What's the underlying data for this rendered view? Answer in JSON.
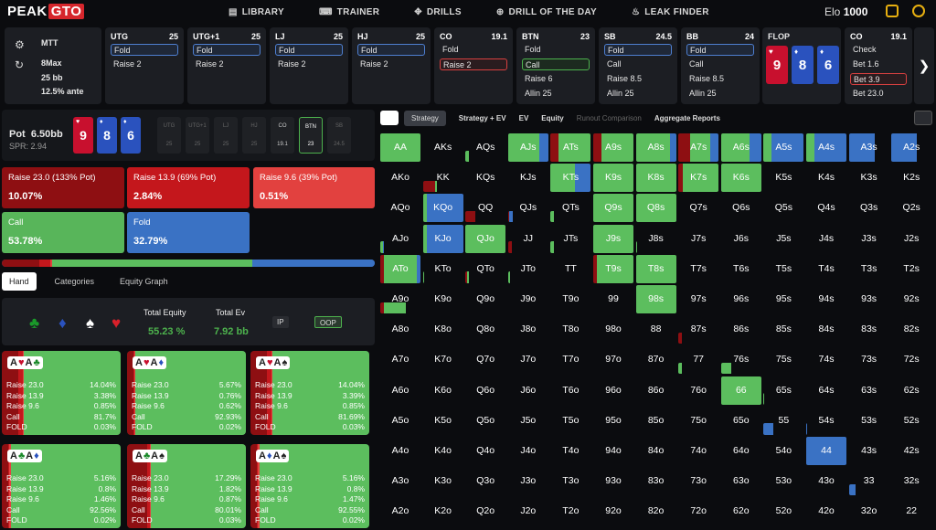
{
  "header": {
    "logo_a": "PEAK",
    "logo_b": "GTO",
    "nav": [
      {
        "label": "LIBRARY",
        "icon": "book-icon"
      },
      {
        "label": "TRAINER",
        "icon": "gamepad-icon"
      },
      {
        "label": "DRILLS",
        "icon": "target-icon"
      },
      {
        "label": "DRILL OF THE DAY",
        "icon": "plus-circle-icon"
      },
      {
        "label": "LEAK FINDER",
        "icon": "flame-icon"
      }
    ],
    "elo_label": "Elo",
    "elo_value": "1000"
  },
  "config": {
    "game": "MTT",
    "table": "8Max",
    "stack": "25 bb",
    "ante": "12.5% ante"
  },
  "positions": [
    {
      "name": "UTG",
      "amount": "25",
      "actions": [
        "Fold",
        "Raise 2"
      ],
      "sel": 0,
      "style": "sel"
    },
    {
      "name": "UTG+1",
      "amount": "25",
      "actions": [
        "Fold",
        "Raise 2"
      ],
      "sel": 0,
      "style": "sel"
    },
    {
      "name": "LJ",
      "amount": "25",
      "actions": [
        "Fold",
        "Raise 2"
      ],
      "sel": 0,
      "style": "sel"
    },
    {
      "name": "HJ",
      "amount": "25",
      "actions": [
        "Fold",
        "Raise 2"
      ],
      "sel": 0,
      "style": "sel"
    },
    {
      "name": "CO",
      "amount": "19.1",
      "actions": [
        "Fold",
        "Raise 2"
      ],
      "sel": 1,
      "style": "selr"
    },
    {
      "name": "BTN",
      "amount": "23",
      "actions": [
        "Fold",
        "Call",
        "Raise 6",
        "Allin 25"
      ],
      "sel": 1,
      "style": "selg"
    },
    {
      "name": "SB",
      "amount": "24.5",
      "actions": [
        "Fold",
        "Call",
        "Raise 8.5",
        "Allin 25"
      ],
      "sel": 0,
      "style": "sel"
    },
    {
      "name": "BB",
      "amount": "24",
      "actions": [
        "Fold",
        "Call",
        "Raise 8.5",
        "Allin 25"
      ],
      "sel": 0,
      "style": "sel"
    }
  ],
  "flop": {
    "label": "FLOP",
    "cards": [
      {
        "r": "9",
        "s": "♥",
        "c": "#c8102e"
      },
      {
        "r": "8",
        "s": "♦",
        "c": "#2a52be"
      },
      {
        "r": "6",
        "s": "♦",
        "c": "#2a52be"
      }
    ]
  },
  "co_col": {
    "name": "CO",
    "amount": "19.1",
    "actions": [
      "Check",
      "Bet 1.6",
      "Bet 3.9",
      "Bet 23.0"
    ],
    "sel": 2
  },
  "board": {
    "pot_label": "Pot",
    "pot": "6.50bb",
    "spr": "SPR: 2.94",
    "seats": [
      {
        "n": "UTG",
        "v": "25"
      },
      {
        "n": "UTG+1",
        "v": "25"
      },
      {
        "n": "LJ",
        "v": "25"
      },
      {
        "n": "HJ",
        "v": "25"
      },
      {
        "n": "CO",
        "v": "19.1"
      },
      {
        "n": "BTN",
        "v": "23"
      },
      {
        "n": "SB",
        "v": "24.5"
      }
    ]
  },
  "actions": [
    {
      "label": "Raise 23.0 (133% Pot)",
      "pct": "10.07%",
      "color": "#8e0f12"
    },
    {
      "label": "Raise 13.9 (69% Pot)",
      "pct": "2.84%",
      "color": "#c4171c"
    },
    {
      "label": "Raise 9.6 (39% Pot)",
      "pct": "0.51%",
      "color": "#e2413f"
    },
    {
      "label": "Call",
      "pct": "53.78%",
      "color": "#58b55a"
    },
    {
      "label": "Fold",
      "pct": "32.79%",
      "color": "#3a72c4"
    }
  ],
  "freq": [
    10.07,
    2.84,
    0.51,
    53.78,
    32.79
  ],
  "tabs": [
    "Hand",
    "Categories",
    "Equity Graph"
  ],
  "equity": {
    "te_label": "Total Equity",
    "te": "55.23 %",
    "ev_label": "Total Ev",
    "ev": "7.92 bb",
    "ip": "IP",
    "oop": "OOP"
  },
  "combos": [
    {
      "cards": [
        [
          "A",
          "♥",
          "#c8102e"
        ],
        [
          "A",
          "♣",
          "#1a8a2a"
        ]
      ],
      "rows": [
        [
          "Raise 23.0",
          "14.04%"
        ],
        [
          "Raise 13.9",
          "3.38%"
        ],
        [
          "Raise 9.6",
          "0.85%"
        ],
        [
          "Call",
          "81.7%"
        ],
        [
          "FOLD",
          "0.03%"
        ]
      ]
    },
    {
      "cards": [
        [
          "A",
          "♥",
          "#c8102e"
        ],
        [
          "A",
          "♦",
          "#2a52be"
        ]
      ],
      "rows": [
        [
          "Raise 23.0",
          "5.67%"
        ],
        [
          "Raise 13.9",
          "0.76%"
        ],
        [
          "Raise 9.6",
          "0.62%"
        ],
        [
          "Call",
          "92.93%"
        ],
        [
          "FOLD",
          "0.02%"
        ]
      ]
    },
    {
      "cards": [
        [
          "A",
          "♥",
          "#c8102e"
        ],
        [
          "A",
          "♠",
          "#222"
        ]
      ],
      "rows": [
        [
          "Raise 23.0",
          "14.04%"
        ],
        [
          "Raise 13.9",
          "3.39%"
        ],
        [
          "Raise 9.6",
          "0.85%"
        ],
        [
          "Call",
          "81.69%"
        ],
        [
          "FOLD",
          "0.03%"
        ]
      ]
    },
    {
      "cards": [
        [
          "A",
          "♣",
          "#1a8a2a"
        ],
        [
          "A",
          "♦",
          "#2a52be"
        ]
      ],
      "rows": [
        [
          "Raise 23.0",
          "5.16%"
        ],
        [
          "Raise 13.9",
          "0.8%"
        ],
        [
          "Raise 9.6",
          "1.46%"
        ],
        [
          "Call",
          "92.56%"
        ],
        [
          "FOLD",
          "0.02%"
        ]
      ]
    },
    {
      "cards": [
        [
          "A",
          "♣",
          "#1a8a2a"
        ],
        [
          "A",
          "♠",
          "#222"
        ]
      ],
      "rows": [
        [
          "Raise 23.0",
          "17.29%"
        ],
        [
          "Raise 13.9",
          "1.82%"
        ],
        [
          "Raise 9.6",
          "0.87%"
        ],
        [
          "Call",
          "80.01%"
        ],
        [
          "FOLD",
          "0.03%"
        ]
      ]
    },
    {
      "cards": [
        [
          "A",
          "♦",
          "#2a52be"
        ],
        [
          "A",
          "♠",
          "#222"
        ]
      ],
      "rows": [
        [
          "Raise 23.0",
          "5.16%"
        ],
        [
          "Raise 13.9",
          "0.8%"
        ],
        [
          "Raise 9.6",
          "1.47%"
        ],
        [
          "Call",
          "92.55%"
        ],
        [
          "FOLD",
          "0.02%"
        ]
      ]
    }
  ],
  "grid_tabs": [
    "Strategy",
    "Strategy + EV",
    "EV",
    "Equity",
    "Runout Comparison",
    "Aggregate Reports"
  ],
  "ranks": [
    "A",
    "K",
    "Q",
    "J",
    "T",
    "9",
    "8",
    "7",
    "6",
    "5",
    "4",
    "3",
    "2"
  ],
  "hands": [
    {
      "h": "AA",
      "m": [
        0,
        0,
        0,
        1,
        0
      ]
    },
    {
      "h": "AKs",
      "m": []
    },
    {
      "h": "AQs",
      "m": [
        0,
        0,
        0,
        0.3,
        0
      ]
    },
    {
      "h": "AJs",
      "m": [
        0,
        0,
        0,
        1,
        0.3
      ]
    },
    {
      "h": "ATs",
      "m": [
        0.2,
        0,
        0,
        0.8,
        0
      ]
    },
    {
      "h": "A9s",
      "m": [
        0.2,
        0,
        0,
        0.8,
        0
      ]
    },
    {
      "h": "A8s",
      "m": [
        0,
        0,
        0,
        0.85,
        0.15
      ]
    },
    {
      "h": "A7s",
      "m": [
        0.3,
        0,
        0,
        0.5,
        0.2
      ]
    },
    {
      "h": "A6s",
      "m": [
        0,
        0,
        0,
        0.7,
        0.3
      ]
    },
    {
      "h": "A5s",
      "m": [
        0,
        0,
        0,
        0.2,
        0.8
      ]
    },
    {
      "h": "A4s",
      "m": [
        0,
        0,
        0,
        0.2,
        0.8
      ]
    },
    {
      "h": "A3s",
      "m": [
        0,
        0,
        0,
        0,
        0.8
      ]
    },
    {
      "h": "A2s",
      "m": [
        0,
        0,
        0,
        0,
        0.8
      ]
    },
    {
      "h": "AKo",
      "m": []
    },
    {
      "h": "KK",
      "m": [
        0.5,
        0,
        0,
        0.1,
        0
      ]
    },
    {
      "h": "KQs",
      "m": []
    },
    {
      "h": "KJs",
      "m": []
    },
    {
      "h": "KTs",
      "m": [
        0,
        0,
        0,
        0.6,
        0.4
      ]
    },
    {
      "h": "K9s",
      "m": [
        0,
        0,
        0,
        1,
        0
      ]
    },
    {
      "h": "K8s",
      "m": [
        0,
        0,
        0,
        1,
        0
      ]
    },
    {
      "h": "K7s",
      "m": [
        0.1,
        0,
        0,
        0.9,
        0
      ]
    },
    {
      "h": "K6s",
      "m": [
        0,
        0,
        0,
        1,
        0
      ]
    },
    {
      "h": "K5s",
      "m": []
    },
    {
      "h": "K4s",
      "m": []
    },
    {
      "h": "K3s",
      "m": []
    },
    {
      "h": "K2s",
      "m": []
    },
    {
      "h": "AQo",
      "m": []
    },
    {
      "h": "KQo",
      "m": [
        0,
        0,
        0,
        0.1,
        0.9
      ]
    },
    {
      "h": "QQ",
      "m": [
        0.5,
        0,
        0,
        0,
        0
      ]
    },
    {
      "h": "QJs",
      "m": [
        0.05,
        0,
        0,
        0,
        0.3
      ]
    },
    {
      "h": "QTs",
      "m": [
        0,
        0,
        0,
        0.3,
        0
      ]
    },
    {
      "h": "Q9s",
      "m": [
        0,
        0,
        0,
        1,
        0
      ]
    },
    {
      "h": "Q8s",
      "m": [
        0,
        0,
        0,
        1,
        0
      ]
    },
    {
      "h": "Q7s",
      "m": []
    },
    {
      "h": "Q6s",
      "m": []
    },
    {
      "h": "Q5s",
      "m": []
    },
    {
      "h": "Q4s",
      "m": []
    },
    {
      "h": "Q3s",
      "m": []
    },
    {
      "h": "Q2s",
      "m": []
    },
    {
      "h": "AJo",
      "m": [
        0,
        0,
        0,
        0.2,
        0.1
      ]
    },
    {
      "h": "KJo",
      "m": [
        0,
        0,
        0,
        0.1,
        0.9
      ]
    },
    {
      "h": "QJo",
      "m": [
        0,
        0,
        0,
        1,
        0
      ]
    },
    {
      "h": "JJ",
      "m": [
        0.3,
        0,
        0,
        0,
        0
      ]
    },
    {
      "h": "JTs",
      "m": [
        0,
        0,
        0,
        0.3,
        0
      ]
    },
    {
      "h": "J9s",
      "m": [
        0,
        0,
        0,
        1,
        0
      ]
    },
    {
      "h": "J8s",
      "m": [
        0,
        0,
        0,
        0.2,
        0
      ]
    },
    {
      "h": "J7s",
      "m": []
    },
    {
      "h": "J6s",
      "m": []
    },
    {
      "h": "J5s",
      "m": []
    },
    {
      "h": "J4s",
      "m": []
    },
    {
      "h": "J3s",
      "m": []
    },
    {
      "h": "J2s",
      "m": []
    },
    {
      "h": "ATo",
      "m": [
        0.1,
        0,
        0,
        0.8,
        0.1
      ]
    },
    {
      "h": "KTo",
      "m": [
        0,
        0,
        0,
        0.2,
        0
      ]
    },
    {
      "h": "QTo",
      "m": [
        0.1,
        0,
        0,
        0.2,
        0
      ]
    },
    {
      "h": "JTo",
      "m": [
        0,
        0,
        0,
        0.2,
        0
      ]
    },
    {
      "h": "TT",
      "m": []
    },
    {
      "h": "T9s",
      "m": [
        0.1,
        0,
        0,
        0.9,
        0
      ]
    },
    {
      "h": "T8s",
      "m": [
        0,
        0,
        0,
        1,
        0
      ]
    },
    {
      "h": "T7s",
      "m": []
    },
    {
      "h": "T6s",
      "m": []
    },
    {
      "h": "T5s",
      "m": []
    },
    {
      "h": "T4s",
      "m": []
    },
    {
      "h": "T3s",
      "m": []
    },
    {
      "h": "T2s",
      "m": []
    },
    {
      "h": "A9o",
      "m": [
        0.1,
        0,
        0,
        0.7,
        0
      ]
    },
    {
      "h": "K9o",
      "m": []
    },
    {
      "h": "Q9o",
      "m": []
    },
    {
      "h": "J9o",
      "m": []
    },
    {
      "h": "T9o",
      "m": []
    },
    {
      "h": "99",
      "m": []
    },
    {
      "h": "98s",
      "m": [
        0,
        0,
        0,
        1,
        0
      ]
    },
    {
      "h": "97s",
      "m": []
    },
    {
      "h": "96s",
      "m": []
    },
    {
      "h": "95s",
      "m": []
    },
    {
      "h": "94s",
      "m": []
    },
    {
      "h": "93s",
      "m": []
    },
    {
      "h": "92s",
      "m": []
    },
    {
      "h": "A8o",
      "m": []
    },
    {
      "h": "K8o",
      "m": []
    },
    {
      "h": "Q8o",
      "m": []
    },
    {
      "h": "J8o",
      "m": []
    },
    {
      "h": "T8o",
      "m": []
    },
    {
      "h": "98o",
      "m": []
    },
    {
      "h": "88",
      "m": []
    },
    {
      "h": "87s",
      "m": [
        0.3,
        0,
        0,
        0,
        0
      ]
    },
    {
      "h": "86s",
      "m": []
    },
    {
      "h": "85s",
      "m": []
    },
    {
      "h": "84s",
      "m": []
    },
    {
      "h": "83s",
      "m": []
    },
    {
      "h": "82s",
      "m": []
    },
    {
      "h": "A7o",
      "m": []
    },
    {
      "h": "K7o",
      "m": []
    },
    {
      "h": "Q7o",
      "m": []
    },
    {
      "h": "J7o",
      "m": []
    },
    {
      "h": "T7o",
      "m": []
    },
    {
      "h": "97o",
      "m": []
    },
    {
      "h": "87o",
      "m": []
    },
    {
      "h": "77",
      "m": [
        0,
        0,
        0,
        0.3,
        0
      ]
    },
    {
      "h": "76s",
      "m": [
        0,
        0,
        0,
        0.5,
        0
      ]
    },
    {
      "h": "75s",
      "m": []
    },
    {
      "h": "74s",
      "m": []
    },
    {
      "h": "73s",
      "m": []
    },
    {
      "h": "72s",
      "m": []
    },
    {
      "h": "A6o",
      "m": []
    },
    {
      "h": "K6o",
      "m": []
    },
    {
      "h": "Q6o",
      "m": []
    },
    {
      "h": "J6o",
      "m": []
    },
    {
      "h": "T6o",
      "m": []
    },
    {
      "h": "96o",
      "m": []
    },
    {
      "h": "86o",
      "m": []
    },
    {
      "h": "76o",
      "m": []
    },
    {
      "h": "66",
      "m": [
        0,
        0,
        0,
        1,
        0
      ]
    },
    {
      "h": "65s",
      "m": [
        0,
        0,
        0,
        0.1,
        0
      ]
    },
    {
      "h": "64s",
      "m": []
    },
    {
      "h": "63s",
      "m": []
    },
    {
      "h": "62s",
      "m": []
    },
    {
      "h": "A5o",
      "m": []
    },
    {
      "h": "K5o",
      "m": []
    },
    {
      "h": "Q5o",
      "m": []
    },
    {
      "h": "J5o",
      "m": []
    },
    {
      "h": "T5o",
      "m": []
    },
    {
      "h": "95o",
      "m": []
    },
    {
      "h": "85o",
      "m": []
    },
    {
      "h": "75o",
      "m": []
    },
    {
      "h": "65o",
      "m": []
    },
    {
      "h": "55",
      "m": [
        0,
        0,
        0,
        0,
        0.5
      ]
    },
    {
      "h": "54s",
      "m": [
        0,
        0,
        0,
        0,
        0.1
      ]
    },
    {
      "h": "53s",
      "m": []
    },
    {
      "h": "52s",
      "m": []
    },
    {
      "h": "A4o",
      "m": []
    },
    {
      "h": "K4o",
      "m": []
    },
    {
      "h": "Q4o",
      "m": []
    },
    {
      "h": "J4o",
      "m": []
    },
    {
      "h": "T4o",
      "m": []
    },
    {
      "h": "94o",
      "m": []
    },
    {
      "h": "84o",
      "m": []
    },
    {
      "h": "74o",
      "m": []
    },
    {
      "h": "64o",
      "m": []
    },
    {
      "h": "54o",
      "m": []
    },
    {
      "h": "44",
      "m": [
        0,
        0,
        0,
        0,
        1
      ]
    },
    {
      "h": "43s",
      "m": []
    },
    {
      "h": "42s",
      "m": []
    },
    {
      "h": "A3o",
      "m": []
    },
    {
      "h": "K3o",
      "m": []
    },
    {
      "h": "Q3o",
      "m": []
    },
    {
      "h": "J3o",
      "m": []
    },
    {
      "h": "T3o",
      "m": []
    },
    {
      "h": "93o",
      "m": []
    },
    {
      "h": "83o",
      "m": []
    },
    {
      "h": "73o",
      "m": []
    },
    {
      "h": "63o",
      "m": []
    },
    {
      "h": "53o",
      "m": []
    },
    {
      "h": "43o",
      "m": []
    },
    {
      "h": "33",
      "m": [
        0,
        0,
        0,
        0,
        0.4
      ]
    },
    {
      "h": "32s",
      "m": []
    },
    {
      "h": "A2o",
      "m": []
    },
    {
      "h": "K2o",
      "m": []
    },
    {
      "h": "Q2o",
      "m": []
    },
    {
      "h": "J2o",
      "m": []
    },
    {
      "h": "T2o",
      "m": []
    },
    {
      "h": "92o",
      "m": []
    },
    {
      "h": "82o",
      "m": []
    },
    {
      "h": "72o",
      "m": []
    },
    {
      "h": "62o",
      "m": []
    },
    {
      "h": "52o",
      "m": []
    },
    {
      "h": "42o",
      "m": []
    },
    {
      "h": "32o",
      "m": []
    },
    {
      "h": "22",
      "m": []
    }
  ],
  "colors": {
    "r23": "#8e0f12",
    "r13": "#c4171c",
    "r9": "#e2413f",
    "call": "#5cbe5e",
    "fold": "#3a72c4",
    "card_bg": "#1c1e23"
  }
}
